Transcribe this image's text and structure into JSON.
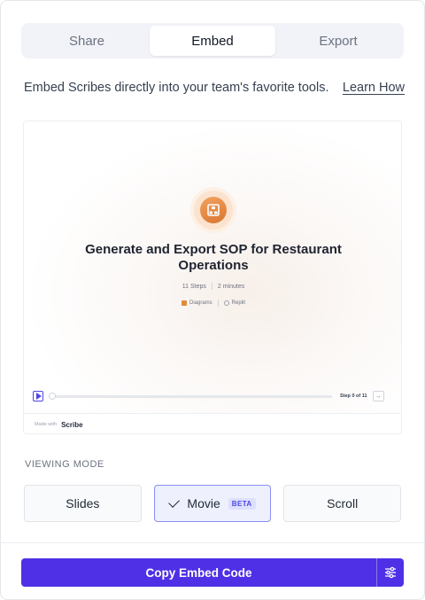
{
  "tabs": [
    {
      "label": "Share",
      "active": false
    },
    {
      "label": "Embed",
      "active": true
    },
    {
      "label": "Export",
      "active": false
    }
  ],
  "description": {
    "text": "Embed Scribes directly into your team's favorite tools.",
    "link": "Learn How"
  },
  "preview": {
    "title": "Generate and Export SOP for Restaurant Operations",
    "steps": "11 Steps",
    "duration": "2 minutes",
    "tags": [
      "Diagrams",
      "Replit"
    ],
    "player_step": "Step 0 of 11",
    "made_with": "Made with",
    "brand": "Scribe"
  },
  "viewing_mode": {
    "label": "VIEWING MODE",
    "options": [
      {
        "label": "Slides",
        "active": false
      },
      {
        "label": "Movie",
        "active": true,
        "badge": "BETA"
      },
      {
        "label": "Scroll",
        "active": false
      }
    ]
  },
  "footer": {
    "copy_label": "Copy Embed Code"
  },
  "colors": {
    "accent": "#4f30e6",
    "active_mode_bg": "#eef0fe",
    "logo_orange": "#e08a3c"
  }
}
